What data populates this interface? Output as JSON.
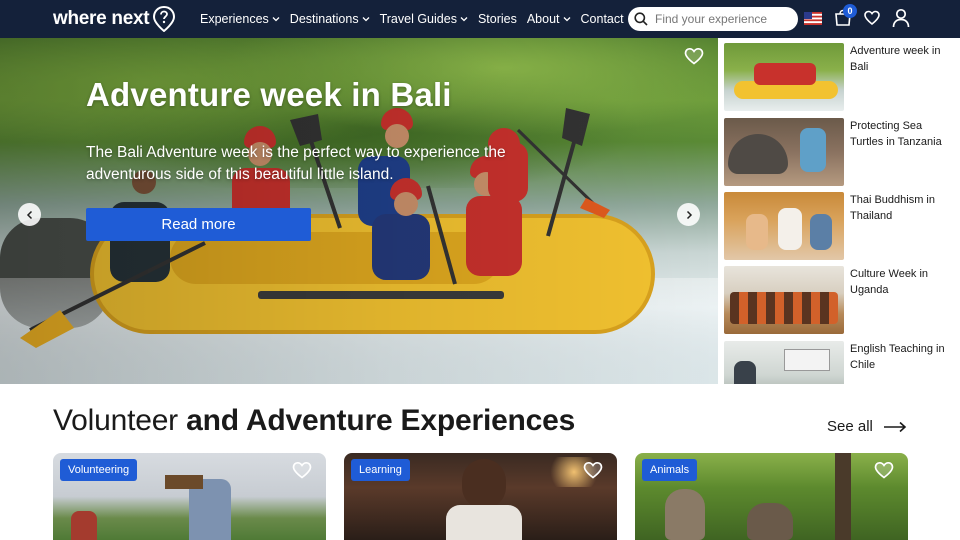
{
  "nav": {
    "logo_text": "where next",
    "menu": [
      {
        "label": "Experiences",
        "has_dropdown": true
      },
      {
        "label": "Destinations",
        "has_dropdown": true
      },
      {
        "label": "Travel Guides",
        "has_dropdown": true
      },
      {
        "label": "Stories",
        "has_dropdown": false
      },
      {
        "label": "About",
        "has_dropdown": true
      },
      {
        "label": "Contact",
        "has_dropdown": false
      }
    ],
    "search_placeholder": "Find your experience",
    "cart_count": "0",
    "icons": [
      "logo-pin-icon",
      "search-icon",
      "us-flag-icon",
      "cart-icon",
      "heart-icon",
      "user-icon"
    ]
  },
  "hero": {
    "title": "Adventure week in Bali",
    "description": "The Bali Adventure week is the perfect way to experience the adventurous side of this beautiful little island.",
    "button_label": "Read more"
  },
  "side_list": [
    {
      "label": "Adventure week in Bali",
      "thumb_icon": "rafting-photo"
    },
    {
      "label": "Protecting Sea Turtles in Tanzania",
      "thumb_icon": "tortoise-photo"
    },
    {
      "label": "Thai Buddhism in Thailand",
      "thumb_icon": "monks-photo"
    },
    {
      "label": "Culture Week in Uganda",
      "thumb_icon": "dancers-photo"
    },
    {
      "label": "English Teaching in Chile",
      "thumb_icon": "classroom-photo"
    }
  ],
  "section": {
    "title_light": "Volunteer",
    "title_bold": "and Adventure Experiences",
    "see_all_label": "See all"
  },
  "cards": [
    {
      "tag": "Volunteering"
    },
    {
      "tag": "Learning"
    },
    {
      "tag": "Animals"
    }
  ],
  "colors": {
    "nav_bg": "#14213a",
    "accent_blue": "#1f5cd6",
    "text_dark": "#1a1a1a"
  }
}
